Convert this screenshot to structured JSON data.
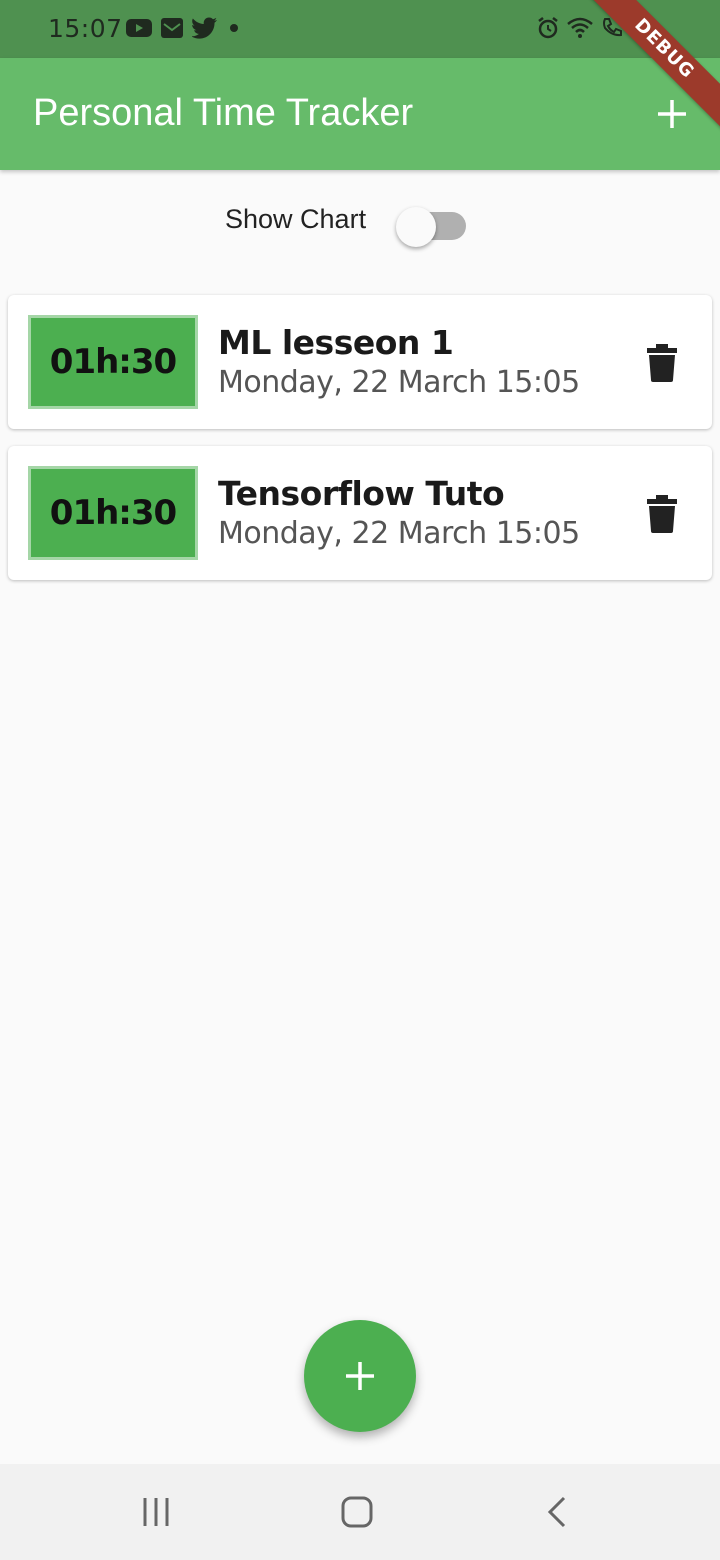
{
  "status_bar": {
    "time": "15:07",
    "left_icons": [
      "youtube-icon",
      "email-icon",
      "twitter-icon",
      "dot-icon"
    ],
    "right_icons": [
      "alarm-icon",
      "wifi-icon",
      "call-icon",
      "signal-icon",
      "battery-icon"
    ]
  },
  "debug_banner": "DEBUG",
  "app_bar": {
    "title": "Personal Time Tracker",
    "add_icon": "plus-icon"
  },
  "chart_toggle": {
    "label": "Show Chart",
    "enabled": false
  },
  "entries": [
    {
      "duration": "01h:30",
      "title": "ML lesseon 1",
      "date": "Monday, 22 March 15:05",
      "delete_icon": "trash-icon"
    },
    {
      "duration": "01h:30",
      "title": "Tensorflow Tuto",
      "date": "Monday, 22 March 15:05",
      "delete_icon": "trash-icon"
    }
  ],
  "fab": {
    "icon": "plus-icon"
  },
  "nav_bar": {
    "buttons": [
      "recent-apps-icon",
      "home-icon",
      "back-icon"
    ]
  },
  "colors": {
    "primary": "#66bb6a",
    "accent": "#4caf50",
    "status_bar": "#4f9150"
  }
}
